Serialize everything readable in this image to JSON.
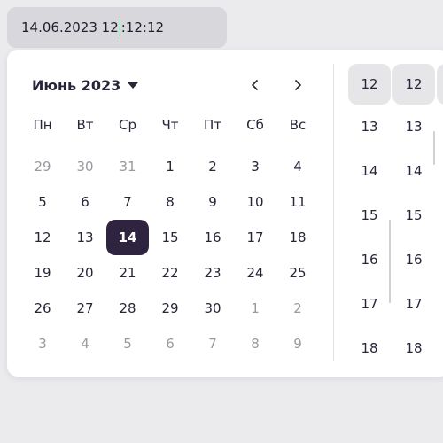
{
  "input": {
    "before_caret": "14.06.2023 12",
    "after_caret": ":12:12"
  },
  "calendar": {
    "month_label": "Июнь 2023",
    "weekdays": [
      "Пн",
      "Вт",
      "Ср",
      "Чт",
      "Пт",
      "Сб",
      "Вс"
    ],
    "weeks": [
      [
        {
          "d": "29",
          "o": true
        },
        {
          "d": "30",
          "o": true
        },
        {
          "d": "31",
          "o": true
        },
        {
          "d": "1"
        },
        {
          "d": "2"
        },
        {
          "d": "3"
        },
        {
          "d": "4"
        }
      ],
      [
        {
          "d": "5"
        },
        {
          "d": "6"
        },
        {
          "d": "7"
        },
        {
          "d": "8"
        },
        {
          "d": "9"
        },
        {
          "d": "10"
        },
        {
          "d": "11"
        }
      ],
      [
        {
          "d": "12"
        },
        {
          "d": "13"
        },
        {
          "d": "14",
          "s": true
        },
        {
          "d": "15"
        },
        {
          "d": "16"
        },
        {
          "d": "17"
        },
        {
          "d": "18"
        }
      ],
      [
        {
          "d": "19"
        },
        {
          "d": "20"
        },
        {
          "d": "21"
        },
        {
          "d": "22"
        },
        {
          "d": "23"
        },
        {
          "d": "24"
        },
        {
          "d": "25"
        }
      ],
      [
        {
          "d": "26"
        },
        {
          "d": "27"
        },
        {
          "d": "28"
        },
        {
          "d": "29"
        },
        {
          "d": "30"
        },
        {
          "d": "1",
          "o": true
        },
        {
          "d": "2",
          "o": true
        }
      ],
      [
        {
          "d": "3",
          "o": true
        },
        {
          "d": "4",
          "o": true
        },
        {
          "d": "5",
          "o": true
        },
        {
          "d": "6",
          "o": true
        },
        {
          "d": "7",
          "o": true
        },
        {
          "d": "8",
          "o": true
        },
        {
          "d": "9",
          "o": true
        }
      ]
    ]
  },
  "time": {
    "hours": [
      "12",
      "13",
      "14",
      "15",
      "16",
      "17",
      "18"
    ],
    "minutes": [
      "12",
      "13",
      "14",
      "15",
      "16",
      "17",
      "18"
    ],
    "seconds": [
      ""
    ],
    "selected_hour": "12",
    "selected_minute": "12"
  },
  "colors": {
    "selected_bg": "#2e2440",
    "caret": "#2bb673",
    "muted": "#9a98a0"
  },
  "icons": {
    "prev": "chevron-left-icon",
    "next": "chevron-right-icon",
    "dropdown": "caret-down-icon"
  }
}
